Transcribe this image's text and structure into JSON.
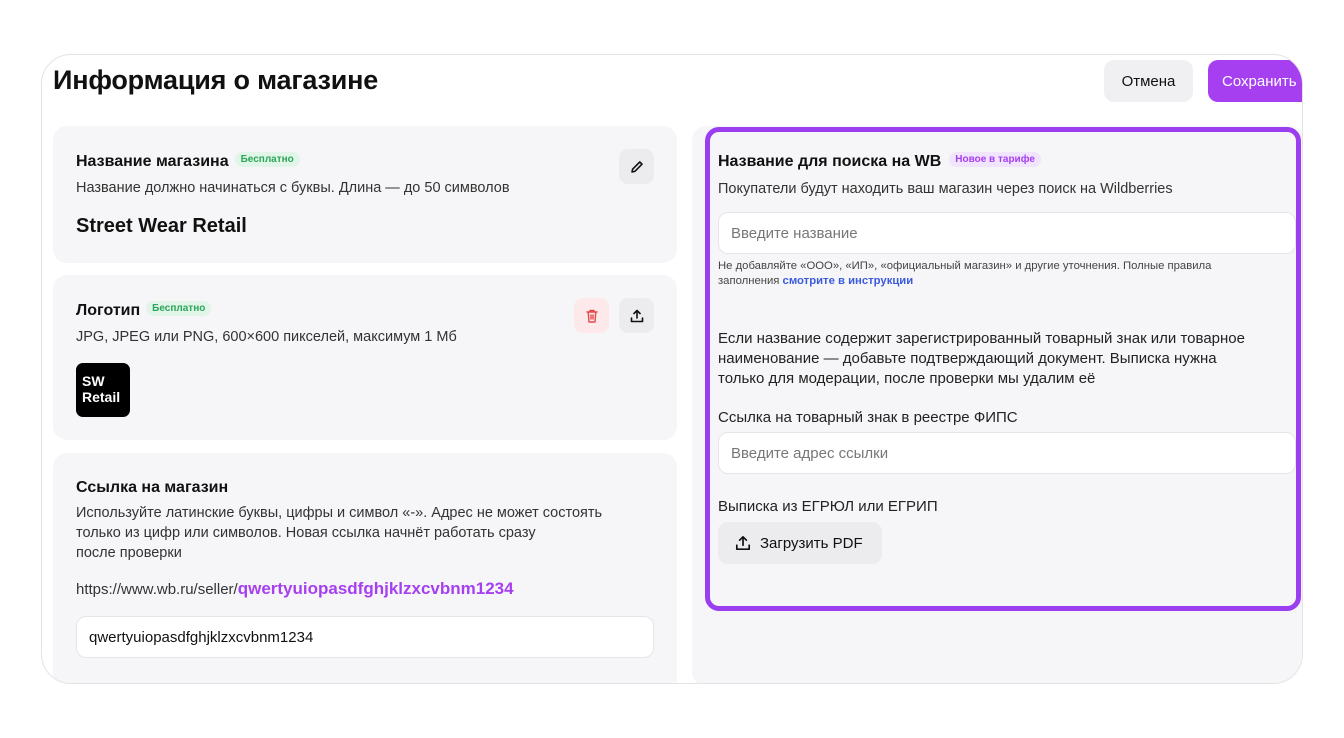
{
  "header": {
    "title": "Информация о магазине",
    "cancel_label": "Отмена",
    "save_label": "Сохранить"
  },
  "store_name_card": {
    "title": "Название магазина",
    "badge": "Бесплатно",
    "hint": "Название должно начинаться с буквы. Длина — до 50 символов",
    "value": "Street Wear Retail",
    "edit_icon": "pencil-icon"
  },
  "logo_card": {
    "title": "Логотип",
    "badge": "Бесплатно",
    "hint": "JPG, JPEG или PNG, 600×600 пикселей, максимум 1 Мб",
    "logo_line1": "SW",
    "logo_line2": "Retail",
    "delete_icon": "trash-icon",
    "upload_icon": "upload-icon"
  },
  "link_card": {
    "title": "Ссылка на магазин",
    "hint_lines": [
      "Используйте латинские буквы, цифры и символ «-». Адрес не может состоять",
      "только из цифр или символов. Новая ссылка начнёт работать сразу",
      "после проверки"
    ],
    "url_prefix": "https://www.wb.ru/seller/",
    "url_slug": "qwertyuiopasdfghjklzxcvbnm1234",
    "input_value": "qwertyuiopasdfghjklzxcvbnm1234"
  },
  "search_name_card": {
    "title": "Название для поиска на WB",
    "badge": "Новое в тарифе",
    "hint": "Покупатели будут находить ваш магазин через поиск на Wildberries",
    "input_placeholder": "Введите название",
    "note_line1": "Не добавляйте «ООО», «ИП», «официальный магазин» и другие уточнения. Полные правила",
    "note_line2_prefix": "заполнения ",
    "note_link": "смотрите в инструкции",
    "trademark_lines": [
      "Если название содержит зарегистрированный товарный знак или товарное",
      "наименование — добавьте подтверждающий документ. Выписка нужна",
      "только для модерации, после проверки мы удалим её"
    ],
    "fips_label": "Ссылка на товарный знак в реестре ФИПС",
    "fips_placeholder": "Введите адрес ссылки",
    "egrul_label": "Выписка из ЕГРЮЛ или ЕГРИП",
    "upload_label": "Загрузить PDF",
    "upload_icon": "upload-icon"
  },
  "colors": {
    "accent": "#a53ff0",
    "highlight_border": "#9b3ef0",
    "free_badge": "#2ca65a",
    "link": "#3b5bdb"
  }
}
